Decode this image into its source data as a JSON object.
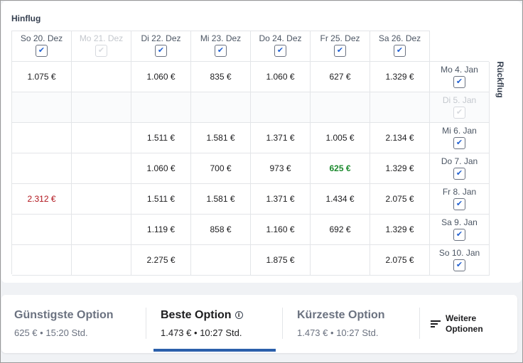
{
  "outbound_label": "Hinflug",
  "return_label": "Rückflug",
  "outbound_dates": [
    {
      "label": "So 20. Dez",
      "checked": true,
      "disabled": false
    },
    {
      "label": "Mo 21. Dez",
      "checked": true,
      "disabled": true
    },
    {
      "label": "Di 22. Dez",
      "checked": true,
      "disabled": false
    },
    {
      "label": "Mi 23. Dez",
      "checked": true,
      "disabled": false
    },
    {
      "label": "Do 24. Dez",
      "checked": true,
      "disabled": false
    },
    {
      "label": "Fr 25. Dez",
      "checked": true,
      "disabled": false
    },
    {
      "label": "Sa 26. Dez",
      "checked": true,
      "disabled": false
    }
  ],
  "return_dates": [
    {
      "label": "Mo 4. Jan",
      "checked": true,
      "disabled": false
    },
    {
      "label": "Di 5. Jan",
      "checked": true,
      "disabled": true
    },
    {
      "label": "Mi 6. Jan",
      "checked": true,
      "disabled": false
    },
    {
      "label": "Do 7. Jan",
      "checked": true,
      "disabled": false
    },
    {
      "label": "Fr 8. Jan",
      "checked": true,
      "disabled": false
    },
    {
      "label": "Sa 9. Jan",
      "checked": true,
      "disabled": false
    },
    {
      "label": "So 10. Jan",
      "checked": true,
      "disabled": false
    }
  ],
  "prices": [
    [
      "1.075 €",
      "",
      "1.060 €",
      "835 €",
      "1.060 €",
      "627 €",
      "1.329 €"
    ],
    [
      "",
      "",
      "",
      "",
      "",
      "",
      ""
    ],
    [
      "",
      "",
      "1.511 €",
      "1.581 €",
      "1.371 €",
      "1.005 €",
      "2.134 €"
    ],
    [
      "",
      "",
      "1.060 €",
      "700 €",
      "973 €",
      "625 €",
      "1.329 €"
    ],
    [
      "2.312 €",
      "",
      "1.511 €",
      "1.581 €",
      "1.371 €",
      "1.434 €",
      "2.075 €"
    ],
    [
      "",
      "",
      "1.119 €",
      "858 €",
      "1.160 €",
      "692 €",
      "1.329 €"
    ],
    [
      "",
      "",
      "2.275 €",
      "",
      "1.875 €",
      "",
      "2.075 €"
    ]
  ],
  "cheapest_cell": {
    "row": 3,
    "col": 5
  },
  "expensive_cell": {
    "row": 4,
    "col": 0
  },
  "colors": {
    "cheapest": "#1c8a2e",
    "expensive": "#b1141c",
    "accent": "#2b5fab"
  },
  "checkbox_icon": "check-icon",
  "options": [
    {
      "title": "Günstigste Option",
      "price": "625 €",
      "duration": "15:20 Std.",
      "active": false,
      "info": false
    },
    {
      "title": "Beste Option",
      "price": "1.473 €",
      "duration": "10:27 Std.",
      "active": true,
      "info": true
    },
    {
      "title": "Kürzeste Option",
      "price": "1.473 €",
      "duration": "10:27 Std.",
      "active": false,
      "info": false
    }
  ],
  "option_separator": "•",
  "info_icon": "info-icon",
  "more_options": {
    "line1": "Weitere",
    "line2": "Optionen",
    "icon": "filter-icon"
  }
}
